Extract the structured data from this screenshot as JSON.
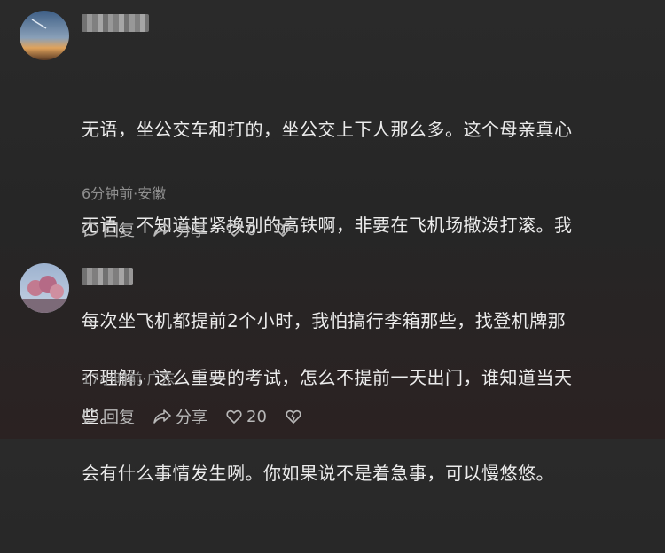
{
  "comments": [
    {
      "text": "无语，坐公交车和打的，坐公交上下人那么多。这个母亲真心无语。不知道赶紧换别的高铁啊，非要在飞机场撒泼打滚。我每次坐飞机都提前2个小时，我怕搞行李箱那些，找登机牌那些。",
      "lines": [
        "无语，坐公交车和打的，坐公交上下人那么多。这个母亲真心",
        "无语。不知道赶紧换别的高铁啊，非要在飞机场撒泼打滚。我",
        "每次坐飞机都提前2个小时，我怕搞行李箱那些，找登机牌那",
        "些。"
      ],
      "meta": "6分钟前·安徽",
      "reply_label": "回复",
      "share_label": "分享",
      "like_count": "0"
    },
    {
      "lines": [
        "不理解，这么重要的考试，怎么不提前一天出门，谁知道当天",
        "会有什么事情发生咧。你如果说不是着急事，可以慢悠悠。"
      ],
      "meta": "17小时前·广东",
      "reply_label": "回复",
      "share_label": "分享",
      "like_count": "20"
    }
  ],
  "icons": {
    "reply": "reply-bubble-icon",
    "share": "share-arrow-icon",
    "like": "heart-icon",
    "dislike": "broken-heart-icon"
  }
}
